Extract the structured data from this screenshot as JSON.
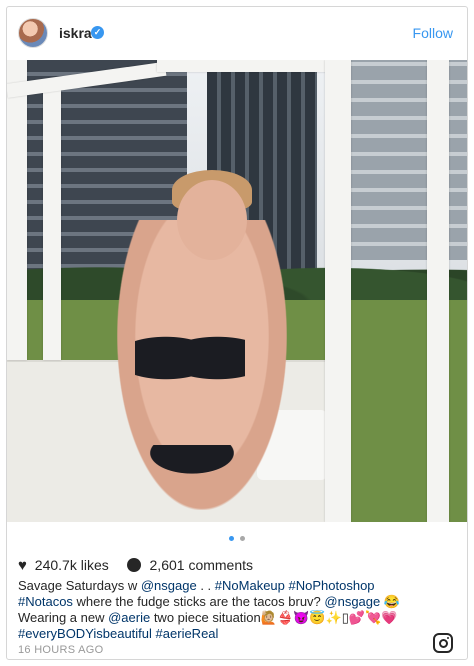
{
  "header": {
    "username": "iskra",
    "follow_label": "Follow",
    "verified_glyph": "✓"
  },
  "post": {
    "carousel": {
      "count": 2,
      "active_index": 0
    },
    "stats": {
      "likes": "240.7k likes",
      "comments": "2,601 comments"
    },
    "caption": {
      "line1_text": "Savage Saturdays w ",
      "mention1": "@nsgage",
      "line1_sep": " . . ",
      "tag1": "#NoMakeup",
      "tag2": "#NoPhotoshop",
      "tag3": "#Notacos",
      "line2_text": " where the fudge sticks are the tacos bruv? ",
      "mention2": "@nsgage",
      "emoji1": "😂",
      "line3_text": "Wearing a new ",
      "mention3": "@aerie",
      "line3_text2": " two piece situation",
      "emoji2": "🙋🏼👙😈😇✨▯💕💘💗",
      "tag4": "#everyBODYisbeautiful",
      "tag5": "#aerieReal"
    },
    "timestamp": "16 HOURS AGO"
  },
  "icons": {
    "heart": "heart-icon",
    "comment": "comment-icon",
    "instagram": "instagram-icon",
    "verified": "verified-badge-icon"
  },
  "colors": {
    "link": "#3897f0",
    "hashtag": "#003569",
    "text": "#262626",
    "muted": "#999999"
  }
}
